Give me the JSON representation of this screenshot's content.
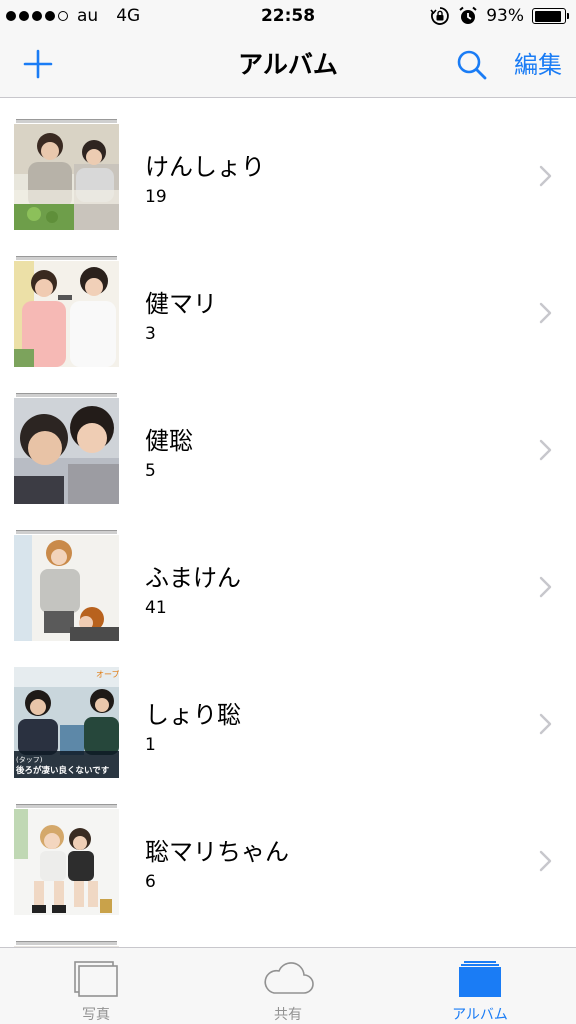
{
  "status_bar": {
    "carrier": "au",
    "network": "4G",
    "time": "22:58",
    "battery": "93%",
    "battery_level": 0.93,
    "signal_bars_filled": 4,
    "signal_bars_total": 5
  },
  "nav": {
    "title": "アルバム",
    "edit_label": "編集",
    "add_icon": "plus-icon",
    "search_icon": "search-icon"
  },
  "albums": [
    {
      "name": "けんしょり",
      "count": "19"
    },
    {
      "name": "健マリ",
      "count": "3"
    },
    {
      "name": "健聡",
      "count": "5"
    },
    {
      "name": "ふまけん",
      "count": "41"
    },
    {
      "name": "しょり聡",
      "count": "1"
    },
    {
      "name": "聡マリちゃん",
      "count": "6"
    }
  ],
  "thumb_captions": {
    "album5_top": "オープ",
    "album5_bottom": "(タッフ)\n後ろが凄い良くないです"
  },
  "tab_bar": {
    "tabs": [
      {
        "label": "写真",
        "icon": "photos-icon"
      },
      {
        "label": "共有",
        "icon": "cloud-icon"
      },
      {
        "label": "アルバム",
        "icon": "albums-icon"
      }
    ],
    "active_index": 2
  },
  "colors": {
    "accent": "#1a7cf5",
    "inactive": "#929292",
    "bar_background": "#f7f7f7",
    "separator": "#c8c7cc"
  }
}
